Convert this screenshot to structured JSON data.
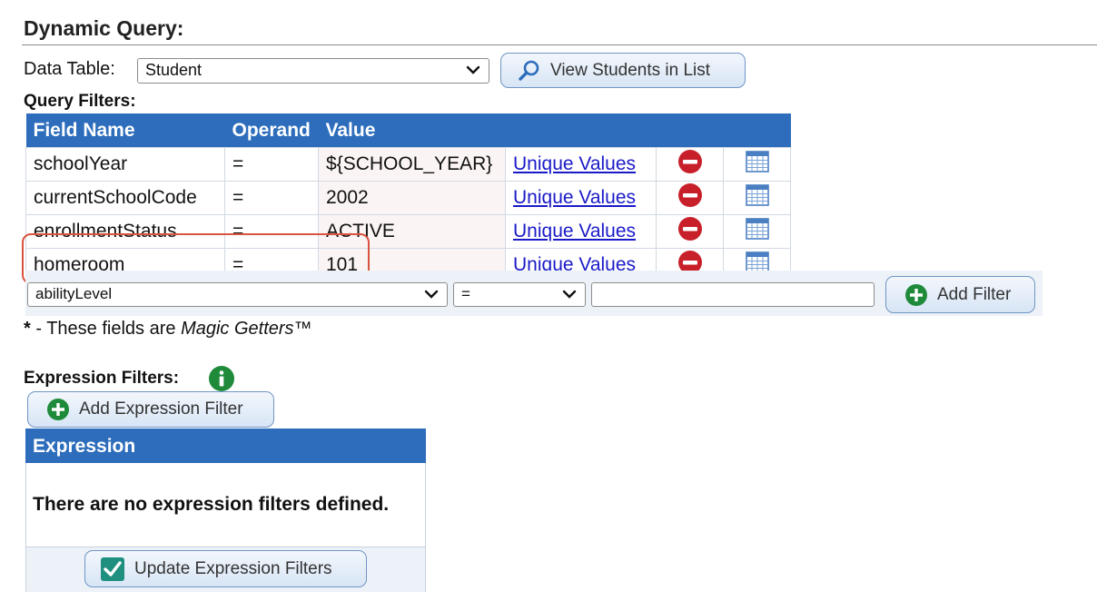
{
  "header": {
    "title": "Dynamic Query:"
  },
  "data_table": {
    "label": "Data Table:",
    "selected": "Student",
    "view_button": "View Students in List"
  },
  "query_filters": {
    "label": "Query Filters:",
    "columns": [
      "Field Name",
      "Operand",
      "Value"
    ],
    "rows": [
      {
        "field": "schoolYear",
        "operand": "=",
        "value": "${SCHOOL_YEAR}",
        "link": "Unique Values"
      },
      {
        "field": "currentSchoolCode",
        "operand": "=",
        "value": "2002",
        "link": "Unique Values"
      },
      {
        "field": "enrollmentStatus",
        "operand": "=",
        "value": "ACTIVE",
        "link": "Unique Values"
      },
      {
        "field": "homeroom",
        "operand": "=",
        "value": "101",
        "link": "Unique Values"
      }
    ],
    "new_filter": {
      "field": "abilityLevel",
      "operand": "=",
      "value": "",
      "add_button": "Add Filter"
    }
  },
  "footnote": {
    "star": "*",
    "text": " - These fields are ",
    "em": "Magic Getters",
    "tm": "™"
  },
  "expression_filters": {
    "label": "Expression Filters:",
    "add_button": "Add Expression Filter",
    "column": "Expression",
    "empty_message": "There are no expression filters defined.",
    "update_button": "Update Expression Filters"
  },
  "colors": {
    "header_blue": "#2d6dbc",
    "link": "#1a1ac8",
    "delete_red": "#c8202a",
    "add_green": "#1f8a3a",
    "highlight": "#d9533e"
  }
}
